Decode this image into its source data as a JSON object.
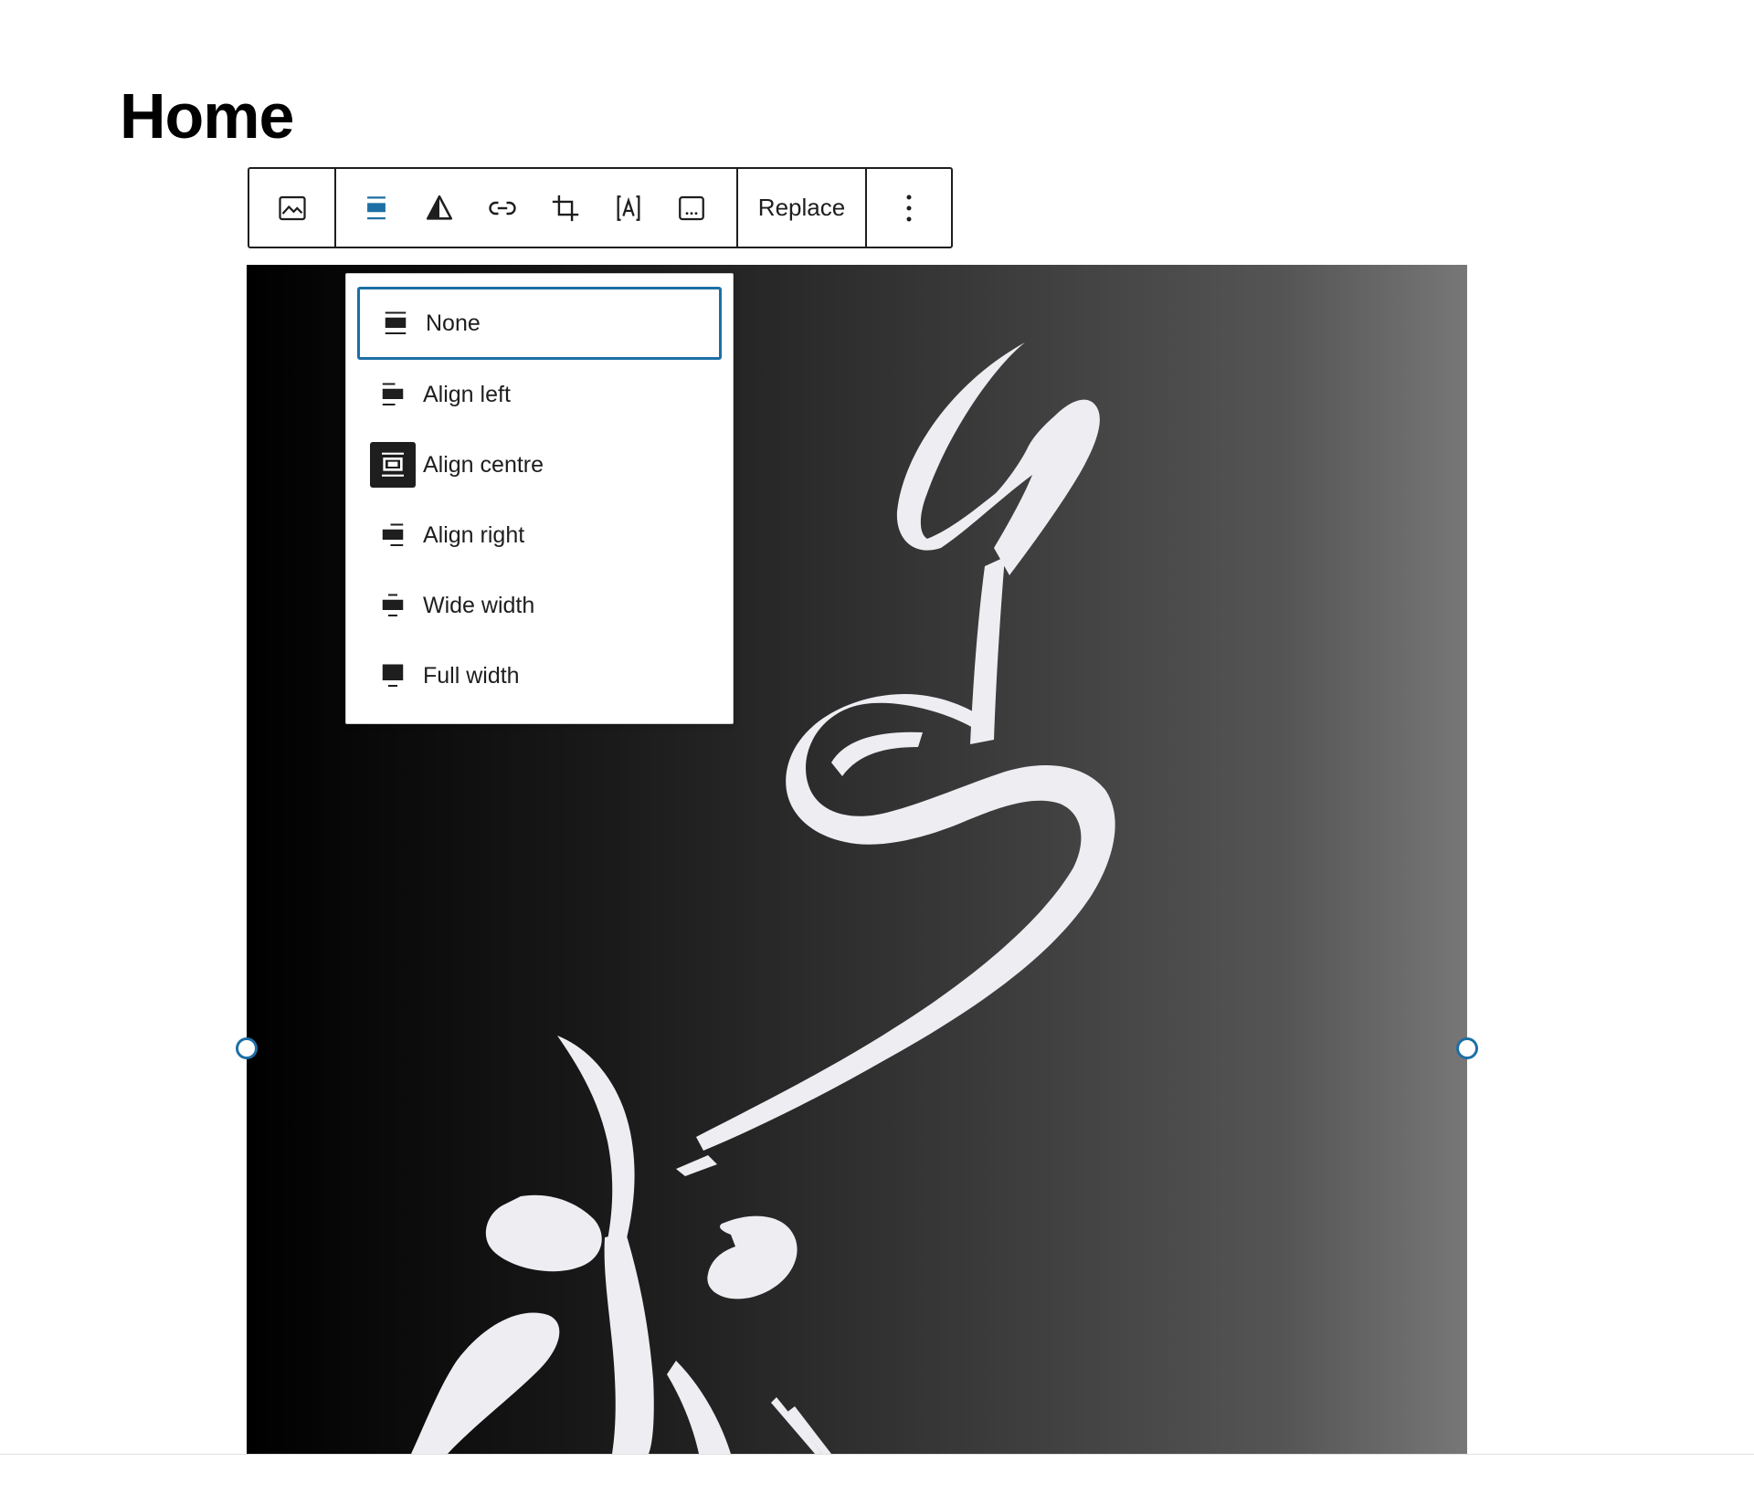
{
  "page": {
    "title": "Home"
  },
  "toolbar": {
    "buttons": [
      {
        "icon": "image-icon"
      },
      {
        "icon": "align-center-icon",
        "color": "#1d6fa5"
      },
      {
        "icon": "duotone-icon"
      },
      {
        "icon": "link-icon"
      },
      {
        "icon": "crop-icon"
      },
      {
        "icon": "text-overlay-icon"
      },
      {
        "icon": "alt-text-icon"
      }
    ],
    "replace_label": "Replace",
    "more_icon": "vertical-ellipsis-icon"
  },
  "align_menu": {
    "items": [
      {
        "label": "None",
        "icon": "align-none-icon",
        "focused": true
      },
      {
        "label": "Align left",
        "icon": "align-left-icon"
      },
      {
        "label": "Align centre",
        "icon": "align-center-icon",
        "active": true
      },
      {
        "label": "Align right",
        "icon": "align-right-icon"
      },
      {
        "label": "Wide width",
        "icon": "align-wide-icon"
      },
      {
        "label": "Full width",
        "icon": "align-full-icon"
      }
    ]
  },
  "colors": {
    "accent": "#1d6fa5",
    "text": "#1e1e1e"
  }
}
